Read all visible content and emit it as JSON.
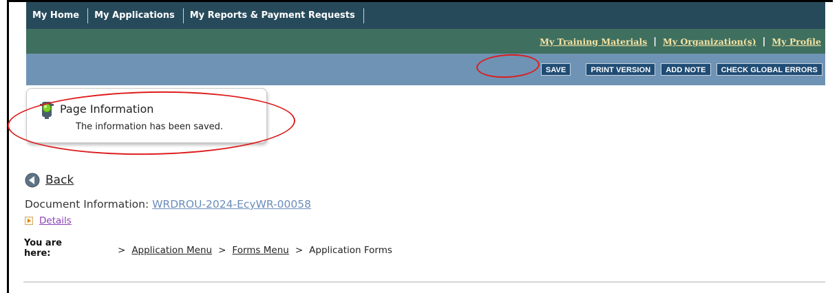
{
  "nav_primary": [
    "My Home",
    "My Applications",
    "My Reports & Payment Requests"
  ],
  "nav_secondary": {
    "training": "My Training Materials",
    "separator": "|",
    "organization": "My Organization(s)",
    "profile": "My Profile"
  },
  "toolbar": {
    "save": "SAVE",
    "print": "PRINT VERSION",
    "add_note": "ADD NOTE",
    "check_errors": "CHECK GLOBAL ERRORS"
  },
  "page_info": {
    "title": "Page Information",
    "message": "The information has been saved."
  },
  "back": "Back",
  "document": {
    "label": "Document Information: ",
    "id": "WRDROU-2024-EcyWR-00058",
    "details": "Details"
  },
  "breadcrumb": {
    "label": "You are here:",
    "sep": ">",
    "items": [
      "Application Menu",
      "Forms Menu",
      "Application Forms"
    ]
  },
  "colors": {
    "nav_primary_bg": "#274a5b",
    "nav_secondary_bg": "#3f6f5f",
    "toolbar_bg": "#6f93b5",
    "button_bg": "#1f4c74",
    "annotation_red": "#dd1c1c"
  }
}
